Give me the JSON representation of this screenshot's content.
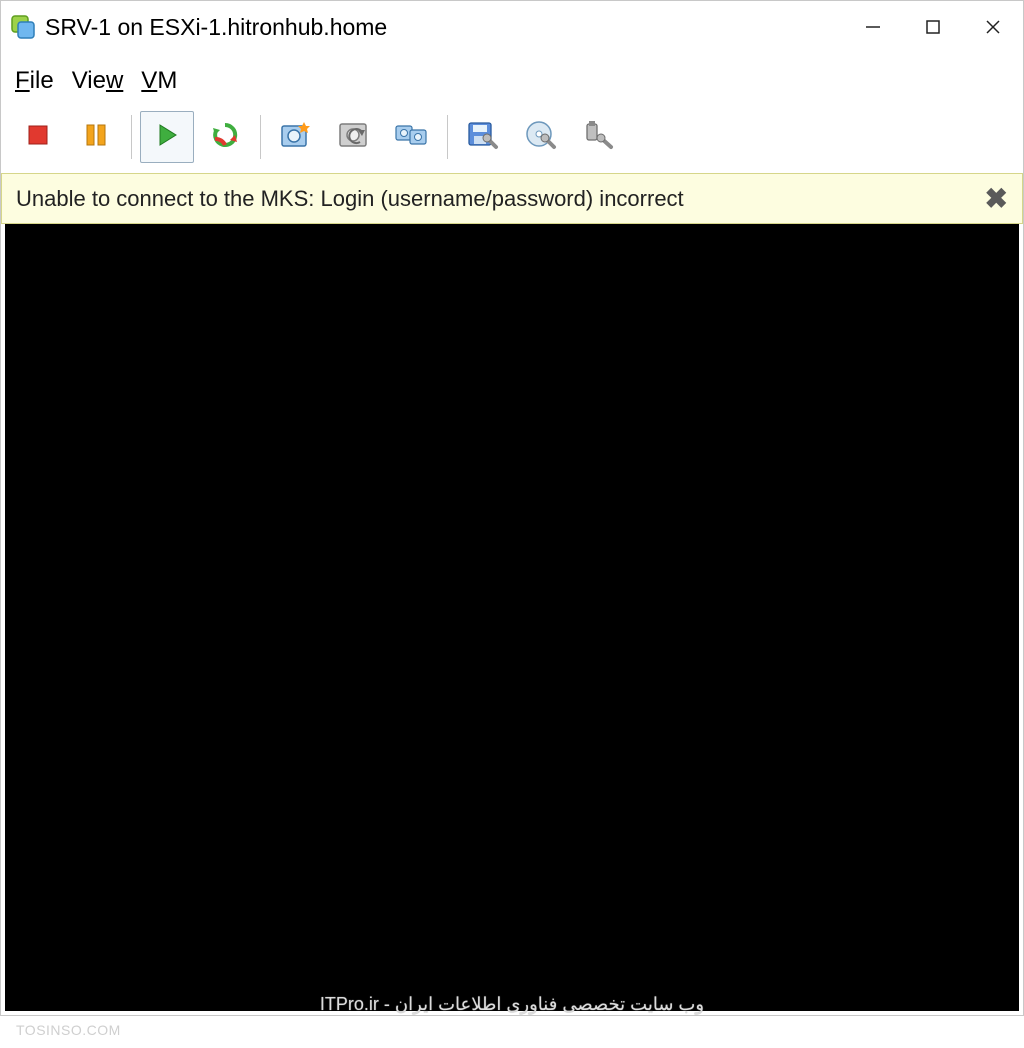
{
  "titlebar": {
    "title": "SRV-1 on ESXi-1.hitronhub.home"
  },
  "menubar": {
    "file": "File",
    "view": "View",
    "vm": "VM"
  },
  "toolbar": {
    "stop": "stop",
    "pause": "pause",
    "play": "play",
    "restart": "restart",
    "snapshot": "snapshot",
    "snapshot_manager": "snapshot-manager",
    "settings": "settings",
    "floppy": "floppy-tool",
    "cd": "cd-tool",
    "usb": "usb-tool"
  },
  "notification": {
    "message": "Unable to connect to the MKS: Login (username/password) incorrect"
  },
  "watermark": {
    "center": "ITPro.ir - وب سایت تخصصی فناوری اطلاعات ایران",
    "corner": "TOSINSO.COM"
  }
}
